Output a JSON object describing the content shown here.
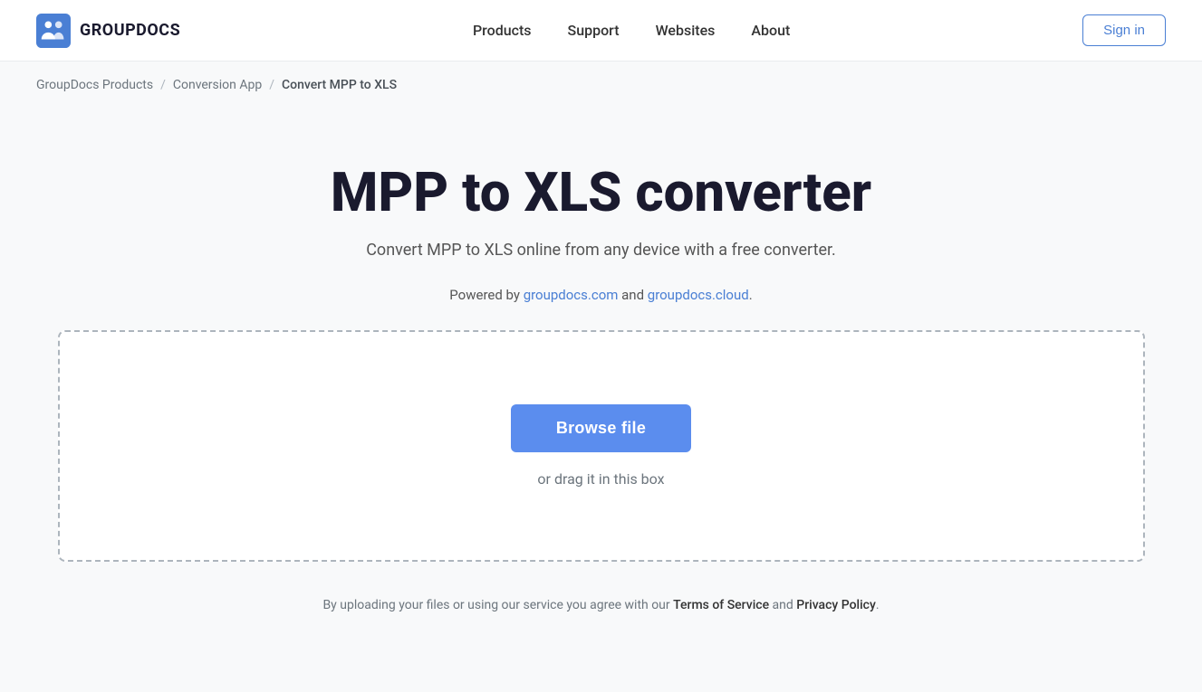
{
  "header": {
    "logo_text": "GROUPDOCS",
    "nav_items": [
      {
        "label": "Products",
        "href": "#"
      },
      {
        "label": "Support",
        "href": "#"
      },
      {
        "label": "Websites",
        "href": "#"
      },
      {
        "label": "About",
        "href": "#"
      }
    ],
    "sign_in_label": "Sign in"
  },
  "breadcrumb": {
    "items": [
      {
        "label": "GroupDocs Products",
        "href": "#"
      },
      {
        "label": "Conversion App",
        "href": "#"
      },
      {
        "label": "Convert MPP to XLS",
        "href": null
      }
    ],
    "separator": "/"
  },
  "main": {
    "title": "MPP to XLS converter",
    "subtitle": "Convert MPP to XLS online from any device with a free converter.",
    "powered_by_prefix": "Powered by ",
    "powered_by_link1_text": "groupdocs.com",
    "powered_by_link1_href": "https://groupdocs.com",
    "powered_by_and": " and ",
    "powered_by_link2_text": "groupdocs.cloud",
    "powered_by_link2_href": "https://groupdocs.cloud",
    "powered_by_suffix": ".",
    "browse_button_label": "Browse file",
    "drag_text": "or drag it in this box",
    "footer_note_prefix": "By uploading your files or using our service you agree with our ",
    "terms_label": "Terms of Service",
    "terms_href": "#",
    "footer_and": " and ",
    "privacy_label": "Privacy Policy",
    "privacy_href": "#",
    "footer_note_suffix": "."
  },
  "colors": {
    "accent": "#5b8dee",
    "accent_hover": "#4a7fd4",
    "border_dashed": "#adb5bd",
    "text_muted": "#6c757d",
    "text_dark": "#1a1a2e"
  }
}
